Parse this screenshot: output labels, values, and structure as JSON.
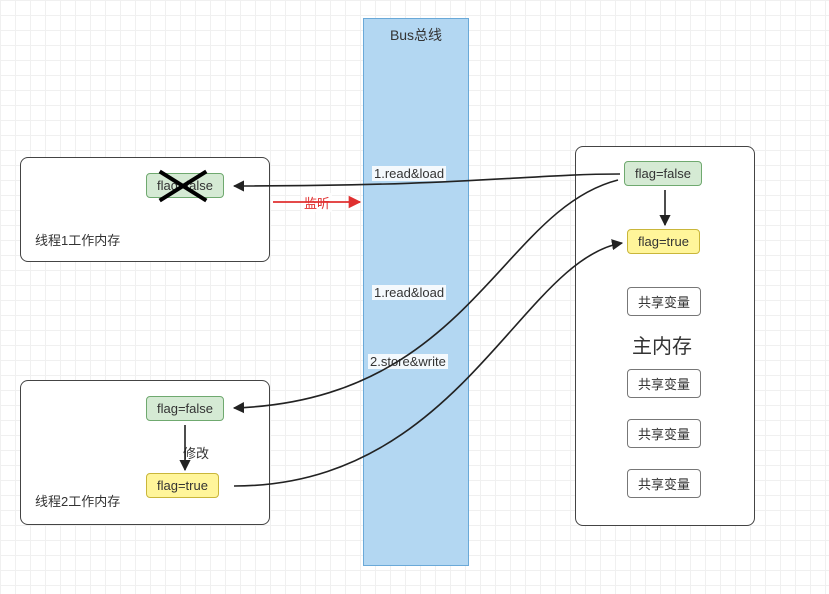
{
  "bus": {
    "title": "Bus总线"
  },
  "thread1": {
    "title": "线程1工作内存",
    "flag": "flag=false"
  },
  "thread2": {
    "title": "线程2工作内存",
    "flag_before": "flag=false",
    "modify_label": "修改",
    "flag_after": "flag=true"
  },
  "mainmem": {
    "title": "主内存",
    "flag_before": "flag=false",
    "flag_after": "flag=true",
    "shared_label": "共享变量"
  },
  "edges": {
    "read_load_1": "1.read&load",
    "read_load_2": "1.read&load",
    "store_write": "2.store&write",
    "listen": "监听"
  }
}
